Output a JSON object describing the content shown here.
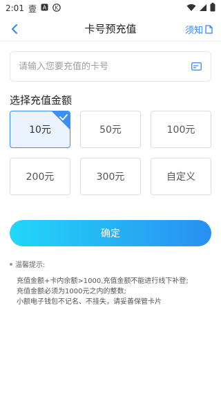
{
  "status_bar": {
    "time": "2:01",
    "notification_glyph": "壹",
    "icons": [
      "a-badge-icon",
      "k-circle-icon",
      "wifi-icon",
      "signal-icon",
      "battery-icon"
    ]
  },
  "nav": {
    "title": "卡号预充值",
    "right_label": "须知"
  },
  "card_input": {
    "placeholder": "请输入您要充值的卡号",
    "value": ""
  },
  "section": {
    "title": "选择充值金额"
  },
  "amounts": [
    {
      "label": "10元",
      "selected": true
    },
    {
      "label": "50元",
      "selected": false
    },
    {
      "label": "100元",
      "selected": false
    },
    {
      "label": "200元",
      "selected": false
    },
    {
      "label": "300元",
      "selected": false
    },
    {
      "label": "自定义",
      "selected": false
    }
  ],
  "confirm": {
    "label": "确定"
  },
  "tips": {
    "title": "温馨提示:",
    "lines": [
      "充值金额+卡内余额>1000,充值金额不能进行线下补登;",
      "充值金额必须为1000元之内的整数;",
      "小额电子钱包不记名、不挂失，请妥善保管卡片"
    ]
  },
  "colors": {
    "accent": "#2f86f6",
    "selected_border": "#3b8ef3",
    "selected_bg": "#eaf3fe",
    "button_gradient_start": "#22d7f7",
    "button_gradient_end": "#2a8ff2"
  }
}
